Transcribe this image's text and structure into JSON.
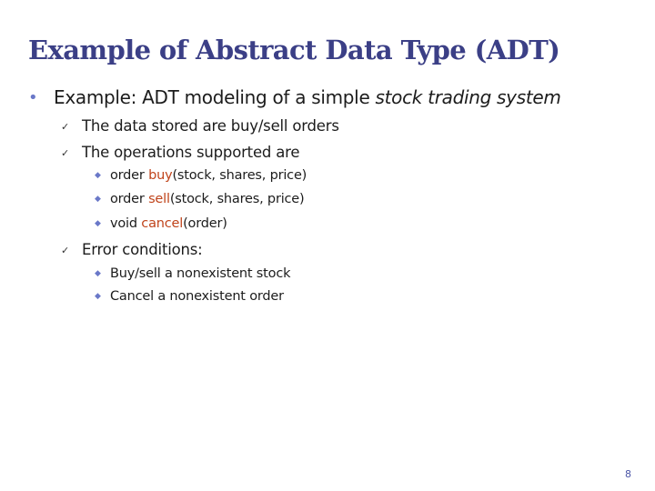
{
  "slide": {
    "title": "Example of Abstract Data Type (ADT)",
    "page_number": "8"
  },
  "content": {
    "item1": {
      "bullet": "•",
      "text": "Example: ADT modeling of a simple ",
      "emphasis": "stock trading system"
    },
    "data_stored": {
      "bullet": "✓",
      "text": "The data stored are buy/sell orders"
    },
    "operations": {
      "bullet": "✓",
      "text": "The operations supported are",
      "items": [
        {
          "bullet": "◆",
          "prefix": "order ",
          "keyword": "buy",
          "suffix": "(stock, shares, price)"
        },
        {
          "bullet": "◆",
          "prefix": "order ",
          "keyword": "sell",
          "suffix": "(stock, shares, price)"
        },
        {
          "bullet": "◆",
          "prefix": "void ",
          "keyword": "cancel",
          "suffix": "(order)"
        }
      ]
    },
    "errors": {
      "bullet": "✓",
      "text": "Error conditions:",
      "items": [
        {
          "bullet": "◆",
          "text": "Buy/sell a nonexistent stock"
        },
        {
          "bullet": "◆",
          "text": "Cancel a nonexistent order"
        }
      ]
    }
  },
  "colors": {
    "title": "#3b3f86",
    "keyword": "#c0441b",
    "bullet_accent": "#6a78c8"
  }
}
